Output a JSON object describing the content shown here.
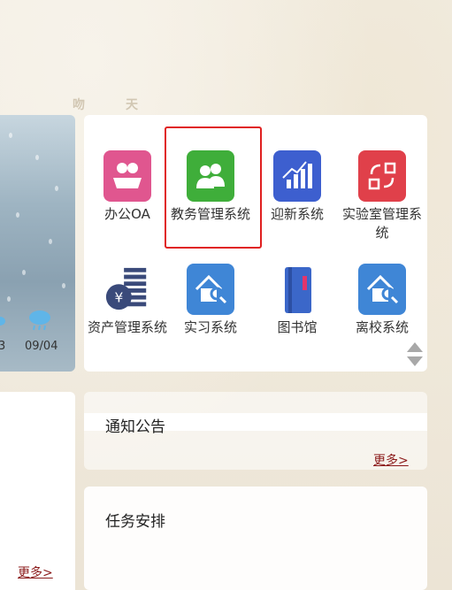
{
  "background_calligraphy": [
    "吻",
    "天"
  ],
  "weather": {
    "dates": [
      "3",
      "09/04"
    ],
    "icon": "cloud-rain-icon"
  },
  "apps": [
    {
      "label": "办公OA",
      "icon": "office-people-icon",
      "color": "#e0568f"
    },
    {
      "label": "教务管理系统",
      "icon": "users-icon",
      "color": "#3fae3a"
    },
    {
      "label": "迎新系统",
      "icon": "bar-chart-icon",
      "color": "#3d5fcf"
    },
    {
      "label": "实验室管理系统",
      "icon": "flow-arrows-icon",
      "color": "#e0404a"
    },
    {
      "label": "资产管理系统",
      "icon": "coin-stack-icon",
      "color": "#3a4a7a"
    },
    {
      "label": "实习系统",
      "icon": "house-search-icon",
      "color": "#3f86d6"
    },
    {
      "label": "图书馆",
      "icon": "book-icon",
      "color": "#3b67c9"
    },
    {
      "label": "离校系统",
      "icon": "house-search-icon",
      "color": "#3f86d6"
    }
  ],
  "highlighted_app": "教务管理系统",
  "notice": {
    "title": "通知公告",
    "more": "更多>"
  },
  "tasks": {
    "title": "任务安排"
  },
  "left_panel": {
    "more": "更多>"
  }
}
